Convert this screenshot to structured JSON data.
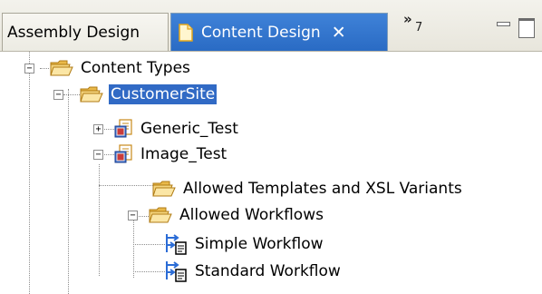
{
  "tabs": {
    "inactive_label": "Assembly Design",
    "active_label": "Content Design",
    "active_close": "✕",
    "overflow_chevron": "»",
    "overflow_count": "7"
  },
  "window_controls": {
    "minimize_icon": "minimize-icon",
    "maximize_icon": "maximize-icon"
  },
  "tree": {
    "nodes": [
      {
        "label": "Content Types",
        "icon": "folder-open-icon",
        "expander": "−"
      },
      {
        "label": "CustomerSite",
        "icon": "folder-open-icon",
        "expander": "−",
        "selected": true
      },
      {
        "label": "Generic_Test",
        "icon": "content-type-icon",
        "expander": "+"
      },
      {
        "label": "Image_Test",
        "icon": "content-type-icon",
        "expander": "−"
      },
      {
        "label": "Allowed Templates and XSL Variants",
        "icon": "folder-open-icon"
      },
      {
        "label": "Allowed Workflows",
        "icon": "folder-open-icon",
        "expander": "−"
      },
      {
        "label": "Simple Workflow",
        "icon": "workflow-icon"
      },
      {
        "label": "Standard Workflow",
        "icon": "workflow-icon"
      }
    ]
  },
  "colors": {
    "selection": "#316ac5",
    "active_tab": "#2a6bc4",
    "folder": "#f3d27a"
  }
}
